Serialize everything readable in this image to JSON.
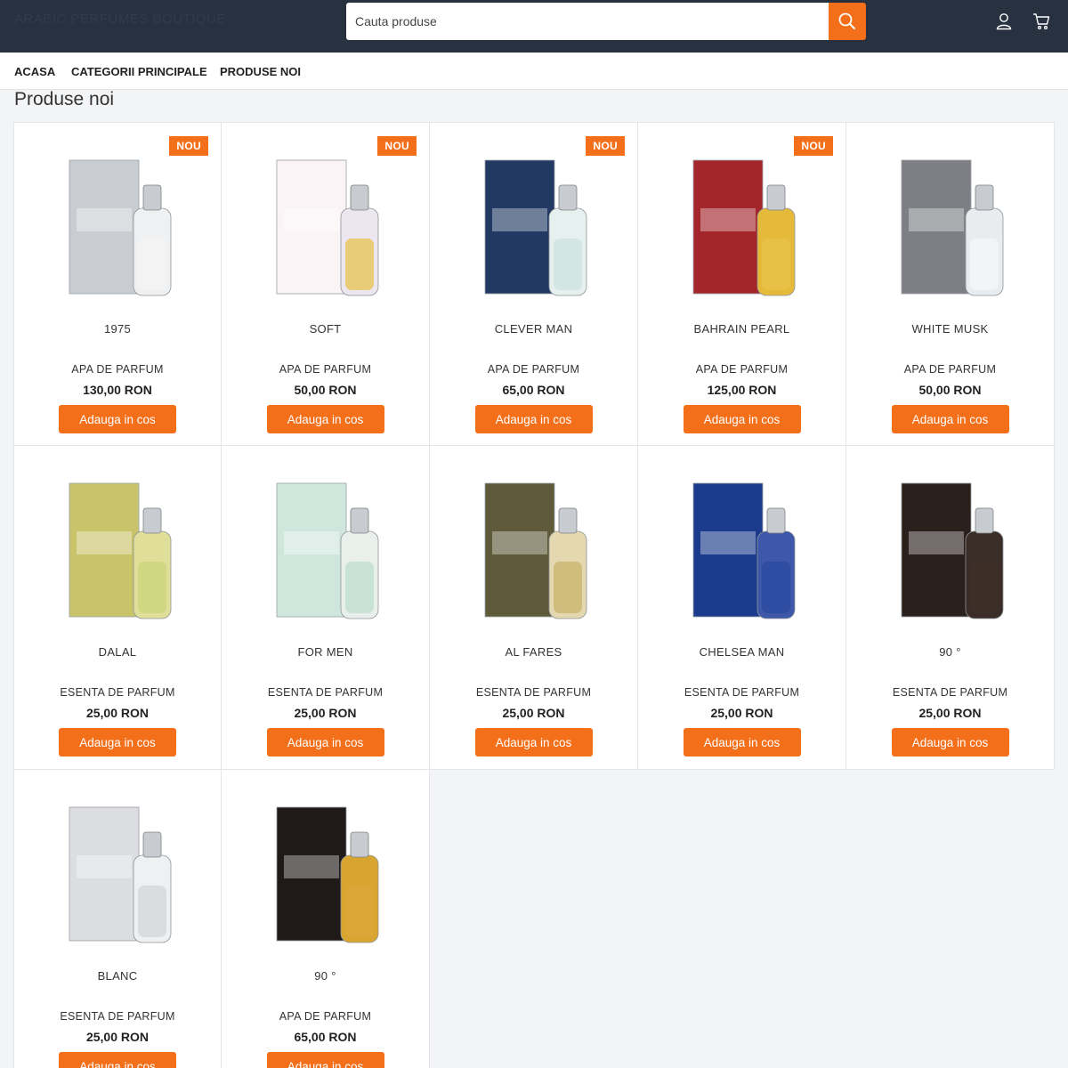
{
  "brand": "ARABIC PERFUMES BOUTIQUE",
  "search": {
    "placeholder": "Cauta produse",
    "icon": "search-icon"
  },
  "header_icons": [
    "user-icon",
    "cart-icon"
  ],
  "nav": [
    {
      "label": "ACASA"
    },
    {
      "label": "CATEGORII PRINCIPALE"
    },
    {
      "label": "PRODUSE NOI"
    }
  ],
  "section_title": "Produse noi",
  "colors": {
    "accent": "#f36f1a",
    "header_bg": "#273140",
    "page_bg": "#f3f4f6"
  },
  "products": [
    {
      "name": "1975",
      "type": "APA DE PARFUM",
      "price": "130,00 RON",
      "button": "Adauga in cos",
      "badge": "NOU",
      "box": "#c9cdd2",
      "bottle": "#eef0f2",
      "liquid": "#f4f4f4"
    },
    {
      "name": "SOFT",
      "type": "APA DE PARFUM",
      "price": "50,00 RON",
      "button": "Adauga in cos",
      "badge": "NOU",
      "box": "#fbf4f7",
      "bottle": "#ece6ef",
      "liquid": "#e8c65a"
    },
    {
      "name": "CLEVER MAN",
      "type": "APA DE PARFUM",
      "price": "65,00 RON",
      "button": "Adauga in cos",
      "badge": "NOU",
      "box": "#223a63",
      "bottle": "#e6f0ee",
      "liquid": "#cfe3df"
    },
    {
      "name": "BAHRAIN PEARL",
      "type": "APA DE PARFUM",
      "price": "125,00 RON",
      "button": "Adauga in cos",
      "badge": "NOU",
      "box": "#a3262a",
      "bottle": "#e5b93a",
      "liquid": "#e9c24a"
    },
    {
      "name": "WHITE MUSK",
      "type": "APA DE PARFUM",
      "price": "50,00 RON",
      "button": "Adauga in cos",
      "box": "#7d7f84",
      "bottle": "#e9ecee",
      "liquid": "#f4f6f7"
    },
    {
      "name": "DALAL",
      "type": "ESENTA DE PARFUM",
      "price": "25,00 RON",
      "button": "Adauga in cos",
      "box": "#c9c46a",
      "bottle": "#e0df9a",
      "liquid": "#cdd37c"
    },
    {
      "name": "FOR MEN",
      "type": "ESENTA DE PARFUM",
      "price": "25,00 RON",
      "button": "Adauga in cos",
      "box": "#cfe6dd",
      "bottle": "#e9f0ec",
      "liquid": "#bfe0d0"
    },
    {
      "name": "AL FARES",
      "type": "ESENTA DE PARFUM",
      "price": "25,00 RON",
      "button": "Adauga in cos",
      "box": "#5f5a3a",
      "bottle": "#e3d8b0",
      "liquid": "#cbb56f"
    },
    {
      "name": "CHELSEA MAN",
      "type": "ESENTA DE PARFUM",
      "price": "25,00 RON",
      "button": "Adauga in cos",
      "box": "#1b3c8c",
      "bottle": "#3d58a8",
      "liquid": "#2a4aa0"
    },
    {
      "name": "90 °",
      "type": "ESENTA DE PARFUM",
      "price": "25,00 RON",
      "button": "Adauga in cos",
      "box": "#2a201c",
      "bottle": "#3a2c27",
      "liquid": "#3e2f28"
    },
    {
      "name": "BLANC",
      "type": "ESENTA DE PARFUM",
      "price": "25,00 RON",
      "button": "Adauga in cos",
      "box": "#dcdde0",
      "bottle": "#eef0f2",
      "liquid": "#d5d8db"
    },
    {
      "name": "90 °",
      "type": "APA DE PARFUM",
      "price": "65,00 RON",
      "button": "Adauga in cos",
      "box": "#1f1a18",
      "bottle": "#d9a531",
      "liquid": "#dca83a"
    }
  ]
}
